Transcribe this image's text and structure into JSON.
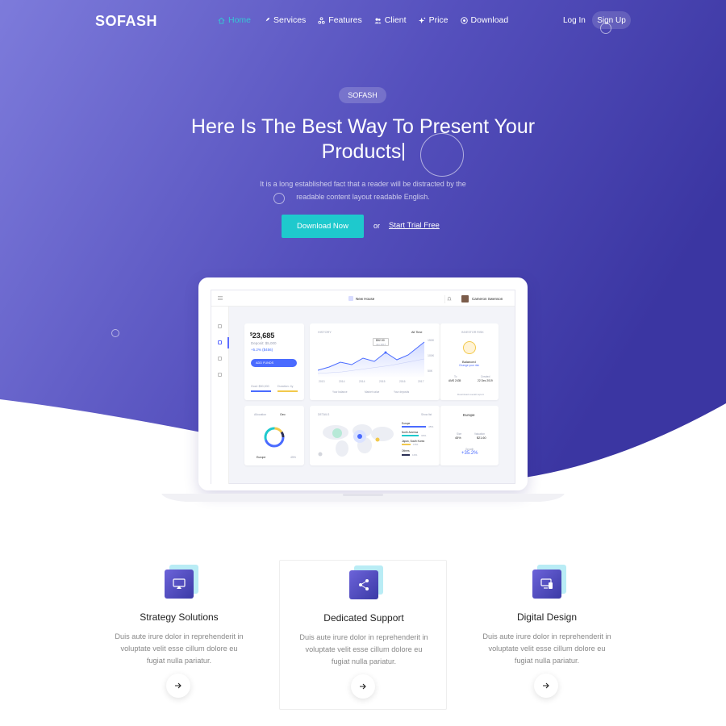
{
  "brand": "SOFASH",
  "nav": {
    "items": [
      {
        "label": "Home",
        "icon": "home-icon",
        "active": true
      },
      {
        "label": "Services",
        "icon": "rocket-icon"
      },
      {
        "label": "Features",
        "icon": "nodes-icon"
      },
      {
        "label": "Client",
        "icon": "users-icon"
      },
      {
        "label": "Price",
        "icon": "sparkle-icon"
      },
      {
        "label": "Download",
        "icon": "download-circle-icon"
      }
    ],
    "login": "Log In",
    "signup": "Sign Up"
  },
  "hero": {
    "badge": "SOFASH",
    "title_line1": "Here Is The Best Way To Present Your",
    "title_line2": "Products",
    "subtitle_line1": "It is a long established fact that a reader will be distracted by the",
    "subtitle_line2": "readable content layout readable English.",
    "cta_primary": "Download Now",
    "or": "or",
    "cta_secondary": "Start Trial Free"
  },
  "dashboard": {
    "breadcrumb": "New House",
    "user": "Cameron Swenson",
    "balance": "23,685",
    "balance_sub": "Deposit: $5,000",
    "balance_change": "+5.2% ($456)",
    "add_funds": "ADD FUNDS",
    "goal_label": "Goal: $50,000",
    "duration_label": "Duration: 4y",
    "history_title": "HISTORY",
    "history_range": "All Time",
    "tooltip_value": "$52.90",
    "tooltip_date": "Jun 2017",
    "y_ticks": [
      "150K",
      "100K",
      "50K"
    ],
    "x_ticks": [
      "2013",
      "2014",
      "2014",
      "2015",
      "2016",
      "2017"
    ],
    "legend": [
      "Your balance",
      "Market value",
      "Your deposits"
    ],
    "risk_title": "INVESTOR RISK",
    "risk_level": "Balanced",
    "risk_link": "Change your risk",
    "to_label": "To",
    "to_value": "AMS 2435",
    "created_label": "Created",
    "created_value": "22 Dec 2019",
    "report": "Download overall report",
    "alloc_tab1": "Allocation",
    "alloc_tab2": "Geo",
    "alloc_region": "Europe",
    "alloc_pct": "45%",
    "map_title": "DETAILS",
    "map_filter": "Show list",
    "regions": [
      {
        "name": "Europe",
        "pct": "45%"
      },
      {
        "name": "North America",
        "pct": "30%"
      },
      {
        "name": "Japan, South Korea",
        "pct": "15%"
      },
      {
        "name": "Others",
        "pct": "10%"
      }
    ],
    "europe_title": "Europe",
    "stat1_label": "Size",
    "stat1_value": "45%",
    "stat2_label": "Valuation",
    "stat2_value": "$21.60",
    "growth_label": "Growth",
    "growth_value": "+35.2%"
  },
  "features": [
    {
      "title": "Strategy Solutions",
      "text": "Duis aute irure dolor in reprehenderit in voluptate velit esse cillum dolore eu fugiat nulla pariatur.",
      "icon": "screen-cast-icon"
    },
    {
      "title": "Dedicated Support",
      "text": "Duis aute irure dolor in reprehenderit in voluptate velit esse cillum dolore eu fugiat nulla pariatur.",
      "icon": "share-icon"
    },
    {
      "title": "Digital Design",
      "text": "Duis aute irure dolor in reprehenderit in voluptate velit esse cillum dolore eu fugiat nulla pariatur.",
      "icon": "devices-icon"
    }
  ],
  "colors": {
    "hero_start": "#7a78d8",
    "hero_end": "#3b36a2",
    "accent": "#1ec9cd",
    "active_nav": "#35c7d5"
  }
}
